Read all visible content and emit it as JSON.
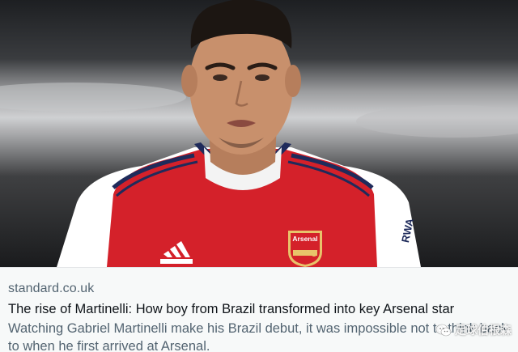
{
  "preview": {
    "domain": "standard.co.uk",
    "title": "The rise of Martinelli: How boy from Brazil transformed into key Arsenal star",
    "description": "Watching Gabriel Martinelli make his Brazil debut, it was impossible not to think back to when he first arrived at Arsenal."
  },
  "photo": {
    "kit_text": "Arsenal",
    "sleeve_text": "RWA",
    "sponsor_logo": "adidas-logo",
    "crest": "arsenal-crest",
    "colors": {
      "red": "#d4212a",
      "white": "#ffffff",
      "navy": "#1f2b5b",
      "skin": "#c8906c",
      "hair": "#1c1612"
    }
  },
  "watermark": {
    "text": "足球伯根森",
    "icon": "wechat-icon"
  }
}
